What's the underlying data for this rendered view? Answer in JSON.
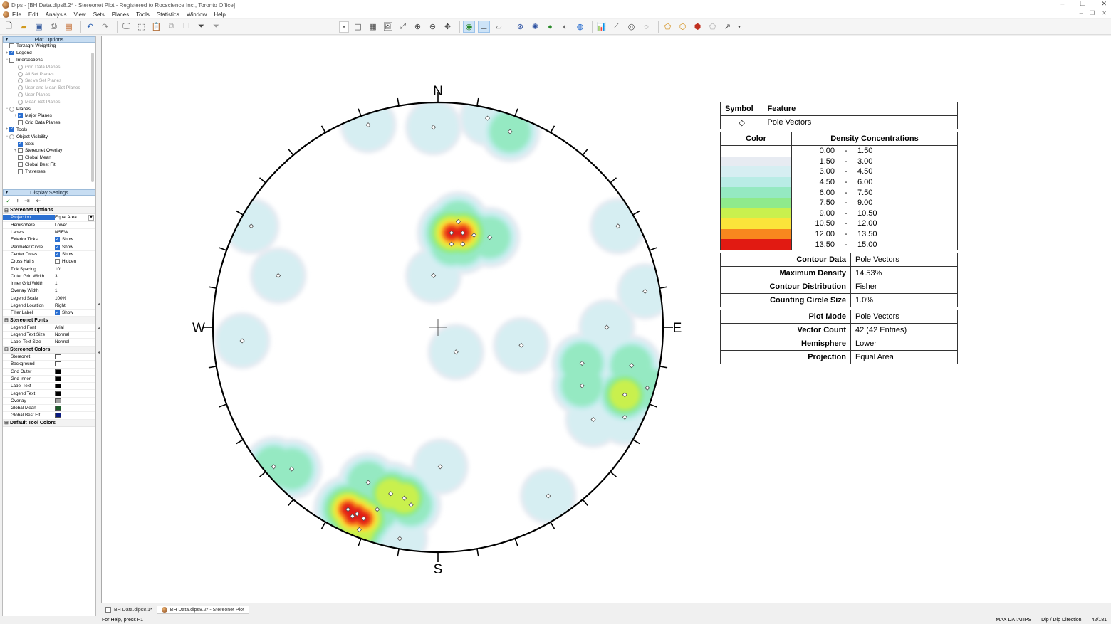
{
  "window": {
    "title": "Dips - [BH Data.dips8.2* - Stereonet Plot - Registered to Rocscience Inc., Toronto Office]"
  },
  "menu": [
    "File",
    "Edit",
    "Analysis",
    "View",
    "Sets",
    "Planes",
    "Tools",
    "Statistics",
    "Window",
    "Help"
  ],
  "plot_options": {
    "header": "Plot Options",
    "tree": [
      {
        "label": "Terzaghi Weighting",
        "level": 1,
        "kind": "cb",
        "checked": false,
        "dim": false
      },
      {
        "label": "Legend",
        "level": 1,
        "kind": "cb",
        "checked": true,
        "dim": false,
        "exp": "+"
      },
      {
        "label": "Intersections",
        "level": 1,
        "kind": "cb",
        "checked": false,
        "dim": false,
        "exp": "−"
      },
      {
        "label": "Grid Data Planes",
        "level": 2,
        "kind": "rb",
        "dim": true
      },
      {
        "label": "All Set Planes",
        "level": 2,
        "kind": "rb",
        "dim": true
      },
      {
        "label": "Set vs Set Planes",
        "level": 2,
        "kind": "rb",
        "dim": true
      },
      {
        "label": "User and Mean Set Planes",
        "level": 2,
        "kind": "rb",
        "dim": true
      },
      {
        "label": "User Planes",
        "level": 2,
        "kind": "rb",
        "dim": true
      },
      {
        "label": "Mean Set Planes",
        "level": 2,
        "kind": "rb",
        "dim": true
      },
      {
        "label": "Planes",
        "level": 1,
        "kind": "rb",
        "dim": false,
        "exp": "−"
      },
      {
        "label": "Major Planes",
        "level": 2,
        "kind": "cb",
        "checked": true,
        "dim": false,
        "exp": "+"
      },
      {
        "label": "Grid Data Planes",
        "level": 2,
        "kind": "cb",
        "checked": false,
        "dim": false
      },
      {
        "label": "Tools",
        "level": 1,
        "kind": "cb",
        "checked": true,
        "dim": false,
        "exp": "+"
      },
      {
        "label": "Object Visibility",
        "level": 1,
        "kind": "rb",
        "dim": false,
        "exp": "−"
      },
      {
        "label": "Sets",
        "level": 2,
        "kind": "cb",
        "checked": true,
        "dim": false
      },
      {
        "label": "Stereonet Overlay",
        "level": 2,
        "kind": "cb",
        "checked": false,
        "dim": false,
        "exp": "+"
      },
      {
        "label": "Global Mean",
        "level": 2,
        "kind": "cb",
        "checked": false,
        "dim": false
      },
      {
        "label": "Global Best Fit",
        "level": 2,
        "kind": "cb",
        "checked": false,
        "dim": false
      },
      {
        "label": "Traverses",
        "level": 2,
        "kind": "cb",
        "checked": false,
        "dim": false
      }
    ]
  },
  "display_settings": {
    "header": "Display Settings",
    "groups": [
      {
        "title": "Stereonet Options",
        "rows": [
          {
            "name": "Projection",
            "value": "Equal Area",
            "type": "dropdown",
            "selected": true
          },
          {
            "name": "Hemisphere",
            "value": "Lower"
          },
          {
            "name": "Labels",
            "value": "NSEW"
          },
          {
            "name": "Exterior Ticks",
            "value": "Show",
            "type": "check",
            "checked": true
          },
          {
            "name": "Perimeter Circle",
            "value": "Show",
            "type": "check",
            "checked": true
          },
          {
            "name": "Center Cross",
            "value": "Show",
            "type": "check",
            "checked": true
          },
          {
            "name": "Cross Hairs",
            "value": "Hidden",
            "type": "check",
            "checked": false
          },
          {
            "name": "Tick Spacing",
            "value": "10°"
          },
          {
            "name": "Outer Grid Width",
            "value": "3"
          },
          {
            "name": "Inner Grid Width",
            "value": "1"
          },
          {
            "name": "Overlay Width",
            "value": "1"
          },
          {
            "name": "Legend Scale",
            "value": "100%"
          },
          {
            "name": "Legend Location",
            "value": "Right"
          },
          {
            "name": "Filter Label",
            "value": "Show",
            "type": "check",
            "checked": true
          }
        ]
      },
      {
        "title": "Stereonet Fonts",
        "rows": [
          {
            "name": "Legend Font",
            "value": "Arial"
          },
          {
            "name": "Legend Text Size",
            "value": "Normal"
          },
          {
            "name": "Label Text Size",
            "value": "Normal"
          }
        ]
      },
      {
        "title": "Stereonet Colors",
        "rows": [
          {
            "name": "Stereonet",
            "value": "",
            "type": "swatch",
            "color": "#ffffff"
          },
          {
            "name": "Background",
            "value": "",
            "type": "swatch",
            "color": "#ffffff"
          },
          {
            "name": "Grid Outer",
            "value": "",
            "type": "swatch",
            "color": "#000000"
          },
          {
            "name": "Grid Inner",
            "value": "",
            "type": "swatch",
            "color": "#000000"
          },
          {
            "name": "Label Text",
            "value": "",
            "type": "swatch",
            "color": "#000000"
          },
          {
            "name": "Legend Text",
            "value": "",
            "type": "swatch",
            "color": "#000000"
          },
          {
            "name": "Overlay",
            "value": "",
            "type": "swatch",
            "color": "#a0a0a0"
          },
          {
            "name": "Global Mean",
            "value": "",
            "type": "swatch",
            "color": "#1d5a2a"
          },
          {
            "name": "Global Best Fit",
            "value": "",
            "type": "swatch",
            "color": "#0a1a80"
          }
        ]
      },
      {
        "title": "Default Tool Colors",
        "rows": []
      }
    ]
  },
  "stereonet": {
    "labels": {
      "north": "N",
      "south": "S",
      "east": "E",
      "west": "W"
    },
    "tick_spacing_deg": 10,
    "poles": [
      [
        -0.31,
        0.9,
        2
      ],
      [
        -0.02,
        0.89,
        2
      ],
      [
        0.22,
        0.93,
        2
      ],
      [
        0.32,
        0.87,
        3
      ],
      [
        0.11,
        0.42,
        5
      ],
      [
        0.06,
        0.42,
        5
      ],
      [
        0.16,
        0.41,
        3
      ],
      [
        0.23,
        0.4,
        3
      ],
      [
        0.09,
        0.47,
        3
      ],
      [
        0.06,
        0.37,
        3
      ],
      [
        0.11,
        0.37,
        3
      ],
      [
        -0.83,
        0.45,
        2
      ],
      [
        -0.71,
        0.23,
        2
      ],
      [
        -0.02,
        0.23,
        2
      ],
      [
        0.8,
        0.45,
        2
      ],
      [
        0.92,
        0.16,
        2
      ],
      [
        -0.87,
        -0.06,
        2
      ],
      [
        0.08,
        -0.11,
        2
      ],
      [
        0.37,
        -0.08,
        2
      ],
      [
        0.75,
        0.0,
        2
      ],
      [
        0.64,
        -0.16,
        3
      ],
      [
        0.64,
        -0.26,
        3
      ],
      [
        0.86,
        -0.17,
        3
      ],
      [
        0.83,
        -0.3,
        4
      ],
      [
        0.93,
        -0.27,
        3
      ],
      [
        0.69,
        -0.41,
        2
      ],
      [
        0.83,
        -0.4,
        2
      ],
      [
        0.01,
        -0.62,
        2
      ],
      [
        -0.73,
        -0.62,
        3
      ],
      [
        -0.65,
        -0.63,
        3
      ],
      [
        -0.31,
        -0.69,
        3
      ],
      [
        0.49,
        -0.75,
        2
      ],
      [
        -0.21,
        -0.74,
        4
      ],
      [
        -0.15,
        -0.76,
        4
      ],
      [
        -0.12,
        -0.79,
        3
      ],
      [
        -0.4,
        -0.81,
        5
      ],
      [
        -0.36,
        -0.83,
        5
      ],
      [
        -0.33,
        -0.85,
        5
      ],
      [
        -0.38,
        -0.84,
        5
      ],
      [
        -0.27,
        -0.81,
        3
      ],
      [
        -0.35,
        -0.9,
        4
      ],
      [
        -0.17,
        -0.94,
        2
      ]
    ]
  },
  "legend": {
    "symbol_header": "Symbol",
    "feature_header": "Feature",
    "symbol_feature": "Pole Vectors",
    "color_header": "Color",
    "density_header": "Density Concentrations",
    "bins": [
      {
        "lo": "0.00",
        "hi": "1.50",
        "color": "#ffffff"
      },
      {
        "lo": "1.50",
        "hi": "3.00",
        "color": "#e7ebf2"
      },
      {
        "lo": "3.00",
        "hi": "4.50",
        "color": "#d6eef2"
      },
      {
        "lo": "4.50",
        "hi": "6.00",
        "color": "#b9ece6"
      },
      {
        "lo": "6.00",
        "hi": "7.50",
        "color": "#95e9c2"
      },
      {
        "lo": "7.50",
        "hi": "9.00",
        "color": "#8fea8c"
      },
      {
        "lo": "9.00",
        "hi": "10.50",
        "color": "#c9f04e"
      },
      {
        "lo": "10.50",
        "hi": "12.00",
        "color": "#fbe43a"
      },
      {
        "lo": "12.00",
        "hi": "13.50",
        "color": "#f8871e"
      },
      {
        "lo": "13.50",
        "hi": "15.00",
        "color": "#e11a12"
      }
    ],
    "stats1": [
      {
        "label": "Contour Data",
        "value": "Pole Vectors"
      },
      {
        "label": "Maximum Density",
        "value": "14.53%"
      },
      {
        "label": "Contour Distribution",
        "value": "Fisher"
      },
      {
        "label": "Counting Circle Size",
        "value": "1.0%"
      }
    ],
    "stats2": [
      {
        "label": "Plot Mode",
        "value": "Pole Vectors"
      },
      {
        "label": "Vector Count",
        "value": "42 (42 Entries)"
      },
      {
        "label": "Hemisphere",
        "value": "Lower"
      },
      {
        "label": "Projection",
        "value": "Equal Area"
      }
    ]
  },
  "tabs": [
    {
      "label": "BH Data.dips8.1*",
      "active": false
    },
    {
      "label": "BH Data.dips8.2* - Stereonet Plot",
      "active": true
    }
  ],
  "status": {
    "help": "For Help, press F1",
    "maxdatatips": "MAX DATATIPS",
    "convention": "Dip / Dip Direction",
    "coord": "42/181"
  }
}
